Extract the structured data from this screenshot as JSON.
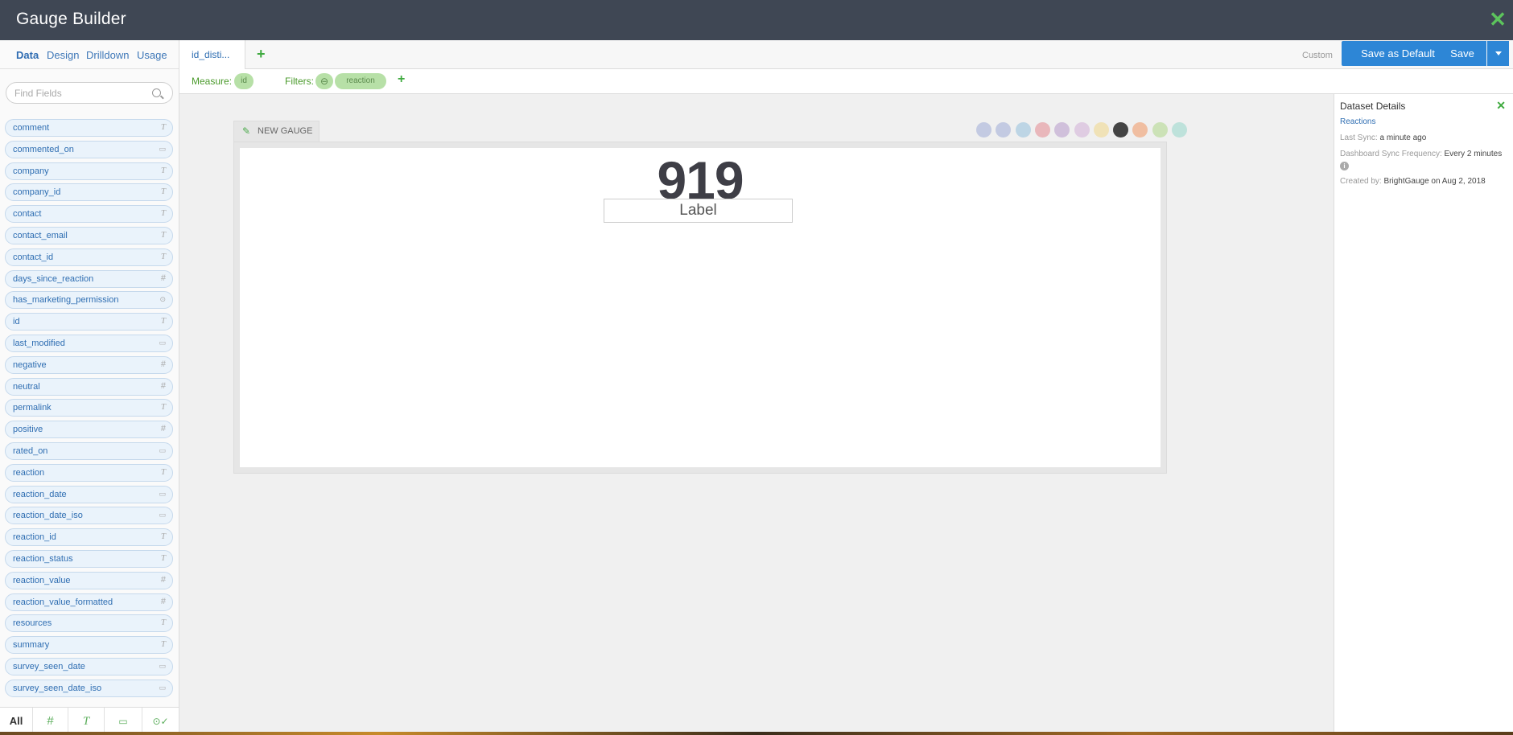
{
  "app": {
    "title": "Gauge Builder"
  },
  "sidebar": {
    "tabs": [
      "Data",
      "Design",
      "Drilldown",
      "Usage"
    ],
    "search_placeholder": "Find Fields",
    "fields": [
      {
        "name": "comment",
        "type": "text"
      },
      {
        "name": "commented_on",
        "type": "date"
      },
      {
        "name": "company",
        "type": "text"
      },
      {
        "name": "company_id",
        "type": "text"
      },
      {
        "name": "contact",
        "type": "text"
      },
      {
        "name": "contact_email",
        "type": "text"
      },
      {
        "name": "contact_id",
        "type": "text"
      },
      {
        "name": "days_since_reaction",
        "type": "number"
      },
      {
        "name": "has_marketing_permission",
        "type": "boolean"
      },
      {
        "name": "id",
        "type": "text"
      },
      {
        "name": "last_modified",
        "type": "date"
      },
      {
        "name": "negative",
        "type": "number"
      },
      {
        "name": "neutral",
        "type": "number"
      },
      {
        "name": "permalink",
        "type": "text"
      },
      {
        "name": "positive",
        "type": "number"
      },
      {
        "name": "rated_on",
        "type": "date"
      },
      {
        "name": "reaction",
        "type": "text"
      },
      {
        "name": "reaction_date",
        "type": "date"
      },
      {
        "name": "reaction_date_iso",
        "type": "date"
      },
      {
        "name": "reaction_id",
        "type": "text"
      },
      {
        "name": "reaction_status",
        "type": "text"
      },
      {
        "name": "reaction_value",
        "type": "number"
      },
      {
        "name": "reaction_value_formatted",
        "type": "number"
      },
      {
        "name": "resources",
        "type": "text"
      },
      {
        "name": "summary",
        "type": "text"
      },
      {
        "name": "survey_seen_date",
        "type": "date"
      },
      {
        "name": "survey_seen_date_iso",
        "type": "date"
      }
    ],
    "type_glyphs": {
      "text": "T",
      "number": "#",
      "date": "▭",
      "boolean": "⊙"
    },
    "footer": {
      "all": "All",
      "num": "#",
      "txt": "T",
      "dt": "▭",
      "bl": "⊙✓"
    }
  },
  "tabs": {
    "gauge_tab": "id_disti...",
    "custom": "Custom",
    "save_default": "Save as Default",
    "save": "Save"
  },
  "measure_bar": {
    "measure_label": "Measure:",
    "measure_value": "id",
    "filters_label": "Filters:",
    "filter_minus": "⊖",
    "filter_value": "reaction"
  },
  "gauge": {
    "title": "NEW GAUGE",
    "value": "919",
    "label": "Label"
  },
  "visualization_icons": [
    {
      "name": "camera-icon",
      "color": "#8b9bd0"
    },
    {
      "name": "table-icon",
      "color": "#8b9bd0"
    },
    {
      "name": "bar-chart-icon",
      "color": "#7fb4d8"
    },
    {
      "name": "line-chart-icon",
      "color": "#e0707a"
    },
    {
      "name": "pie-chart-icon",
      "color": "#a886c0"
    },
    {
      "name": "horizontal-bar-icon",
      "color": "#c9a0d0"
    },
    {
      "name": "list-icon",
      "color": "#f0d070"
    },
    {
      "name": "number-icon",
      "color": "#444444"
    },
    {
      "name": "gauge-icon",
      "color": "#f08040"
    },
    {
      "name": "grid-icon",
      "color": "#a0d070"
    },
    {
      "name": "funnel-icon",
      "color": "#80d0c0"
    }
  ],
  "dataset": {
    "title": "Dataset Details",
    "name": "Reactions",
    "last_sync_label": "Last Sync:",
    "last_sync_value": "a minute ago",
    "freq_label": "Dashboard Sync Frequency:",
    "freq_value": "Every 2 minutes",
    "created_label": "Created by:",
    "created_value": "BrightGauge on Aug 2, 2018"
  }
}
